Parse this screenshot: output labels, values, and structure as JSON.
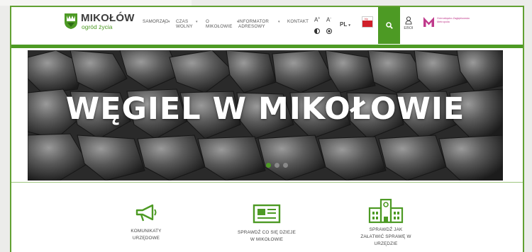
{
  "logo": {
    "title": "MIKOŁÓW",
    "subtitle": "ogród życia"
  },
  "nav": {
    "items": [
      {
        "line1": "SAMORZĄD",
        "line2": "",
        "caret": "▾"
      },
      {
        "line1": "CZAS",
        "line2": "WOLNY",
        "caret": "▾"
      },
      {
        "line1": "O",
        "line2": "MIKOŁOWIE",
        "caret": "▾"
      },
      {
        "line1": "INFORMATOR",
        "line2": "ADRESOWY",
        "caret": "▾"
      },
      {
        "line1": "KONTAKT",
        "line2": "",
        "caret": ""
      }
    ],
    "separator_caret": "▾"
  },
  "accessibility": {
    "font_a": "A",
    "font_plus": "+",
    "font_minus": "-"
  },
  "language": {
    "current": "PL",
    "caret": "▾"
  },
  "bip": {
    "label": "bip"
  },
  "search": {
    "icon": "search-icon"
  },
  "ebok": {
    "label": "EBOI"
  },
  "metro": {
    "text": "Górnośląsko-Zagłębiowska Metropolia"
  },
  "hero": {
    "title": "WĘGIEL W MIKOŁOWIE",
    "next": "›",
    "slides": 3,
    "active_slide": 1
  },
  "tiles": [
    {
      "icon": "megaphone-icon",
      "line1": "KOMUNIKATY",
      "line2": "URZĘDOWE",
      "line3": ""
    },
    {
      "icon": "newspaper-icon",
      "line1": "SPRAWDŹ CO SIĘ DZIEJE",
      "line2": "W MIKOŁOWIE",
      "line3": ""
    },
    {
      "icon": "city-hall-icon",
      "line1": "SPRAWDŹ JAK",
      "line2": "ZAŁATWIĆ SPRAWĘ W",
      "line3": "URZĘDZIE"
    }
  ],
  "colors": {
    "accent": "#4d9a24",
    "bip_red": "#d0202a",
    "metro_pink": "#c03a8c"
  }
}
